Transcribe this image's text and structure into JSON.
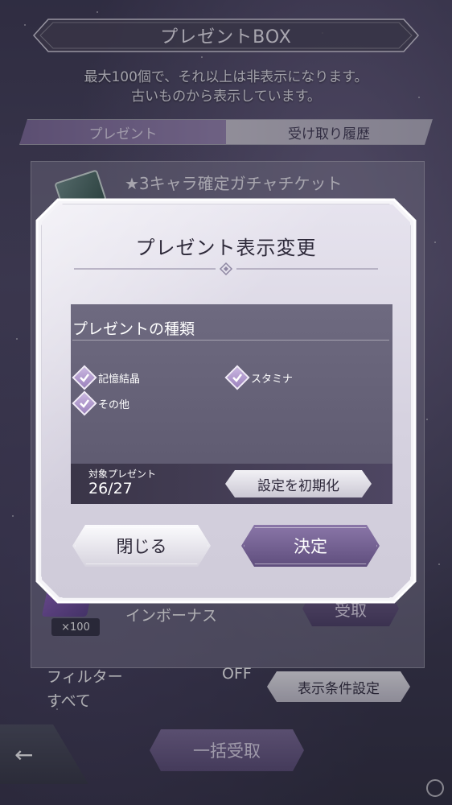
{
  "header": {
    "title": "プレゼントBOX",
    "notice_line1": "最大100個で、それ以上は非表示になります。",
    "notice_line2": "古いものから表示しています。"
  },
  "tabs": [
    {
      "label": "プレゼント",
      "active": true
    },
    {
      "label": "受け取り履歴",
      "active": false
    }
  ],
  "list": {
    "item1_title": "★3キャラ確定ガチャチケット",
    "item2_name": "インボーナス",
    "item2_qty": "×100",
    "receive_label": "受取"
  },
  "footer": {
    "filter_label": "フィルター",
    "filter_state": "OFF",
    "filter_value": "すべて",
    "filter_settings_button": "表示条件設定",
    "bulk_receive_button": "一括受取",
    "back_icon": "←"
  },
  "modal": {
    "title": "プレゼント表示変更",
    "section_title": "プレゼントの種類",
    "options": [
      {
        "label": "記憶結晶",
        "checked": true
      },
      {
        "label": "スタミナ",
        "checked": true
      },
      {
        "label": "その他",
        "checked": true
      }
    ],
    "count_label": "対象プレゼント",
    "count_value": "26/27",
    "reset_button": "設定を初期化",
    "close_button": "閉じる",
    "confirm_button": "決定"
  },
  "colors": {
    "accent": "#7b6a97",
    "checkbox": "#b39ad0",
    "panel": "#645f78"
  }
}
